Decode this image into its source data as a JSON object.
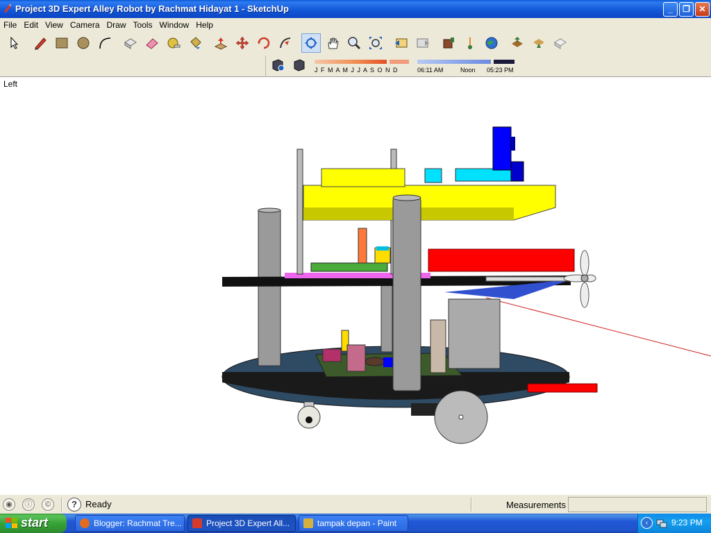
{
  "window": {
    "title": "Project 3D Expert Alley Robot by Rachmat Hidayat 1 - SketchUp",
    "min": "_",
    "max": "❐",
    "close": "✕"
  },
  "menu": [
    "File",
    "Edit",
    "View",
    "Camera",
    "Draw",
    "Tools",
    "Window",
    "Help"
  ],
  "toolbar": {
    "tools": [
      "select-icon",
      "pencil-icon",
      "rectangle-icon",
      "circle-icon",
      "arc-icon",
      "make-component-icon",
      "eraser-icon",
      "tape-measure-icon",
      "paint-bucket-icon",
      "push-pull-icon",
      "move-icon",
      "rotate-icon",
      "follow-me-icon",
      "orbit-icon",
      "pan-icon",
      "zoom-icon",
      "zoom-extents-icon",
      "previous-view-icon",
      "next-view-icon",
      "get-models-icon",
      "place-model-icon",
      "google-earth-icon",
      "terrain-icon",
      "share-model-icon",
      "get-current-view-icon",
      "share-component-icon"
    ],
    "active_tool": "orbit-icon"
  },
  "shadows": {
    "months": "J  F  M  A  M  J  J  A  S  O  N  D",
    "time_start": "06:11 AM",
    "time_mid": "Noon",
    "time_end": "05:23 PM"
  },
  "viewport": {
    "view_name": "Left",
    "background": "#ffffff"
  },
  "statusbar": {
    "status": "Ready",
    "help": "?",
    "measurements_label": "Measurements",
    "measurements_value": ""
  },
  "taskbar": {
    "start": "start",
    "tasks": [
      {
        "label": "Blogger: Rachmat Tre...",
        "icon": "firefox-icon"
      },
      {
        "label": "Project 3D Expert All...",
        "icon": "sketchup-icon"
      },
      {
        "label": "tampak depan - Paint",
        "icon": "paint-icon"
      }
    ],
    "clock": "9:23 PM"
  },
  "colors": {
    "title_blue": "#0a5ad9",
    "chassis": "#2f4a63",
    "chassis_top": "#1a1a1a",
    "yellow_board": "#ffff00",
    "red_block": "#ff0000",
    "cyan_box": "#00e0ff",
    "blue_servo": "#0000ff",
    "pillar_gray": "#9a9a9a"
  }
}
